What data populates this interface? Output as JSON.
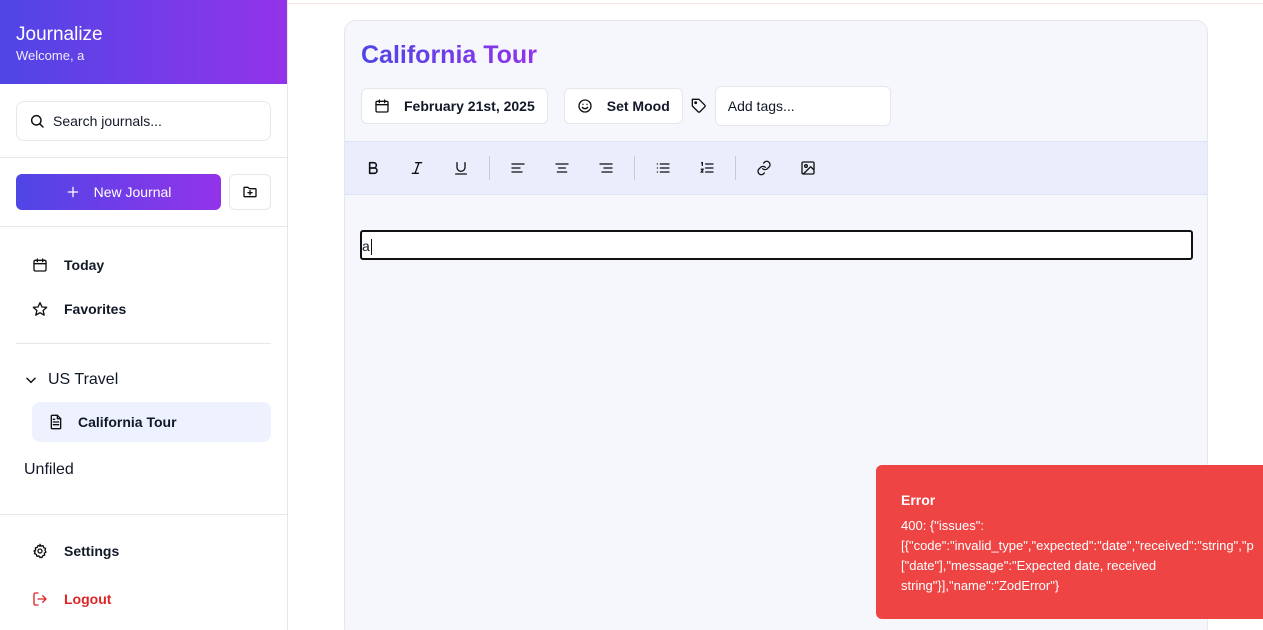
{
  "app": {
    "title": "Journalize",
    "welcome": "Welcome, a"
  },
  "search": {
    "placeholder": "Search journals..."
  },
  "actions": {
    "new_journal": "New Journal"
  },
  "nav": {
    "today": "Today",
    "favorites": "Favorites"
  },
  "folders": [
    {
      "name": "US Travel",
      "expanded": true,
      "journals": [
        "California Tour"
      ]
    }
  ],
  "unfiled": "Unfiled",
  "bottom_nav": {
    "settings": "Settings",
    "logout": "Logout"
  },
  "entry": {
    "title": "California Tour",
    "date": "February 21st, 2025",
    "mood": "Set Mood",
    "tags_placeholder": "Add tags...",
    "content": "a"
  },
  "toolbar": [
    "bold-icon",
    "italic-icon",
    "underline-icon",
    "align-left-icon",
    "align-center-icon",
    "align-right-icon",
    "bullet-list-icon",
    "ordered-list-icon",
    "link-icon",
    "image-icon"
  ],
  "toast": {
    "title": "Error",
    "message": "400: {\"issues\":\n[{\"code\":\"invalid_type\",\"expected\":\"date\",\"received\":\"string\",\"p\n[\"date\"],\"message\":\"Expected date, received\nstring\"}],\"name\":\"ZodError\"}"
  },
  "colors": {
    "brand_start": "#4f46e5",
    "brand_end": "#9333ea",
    "error": "#ef4444",
    "logout": "#dc2626"
  }
}
